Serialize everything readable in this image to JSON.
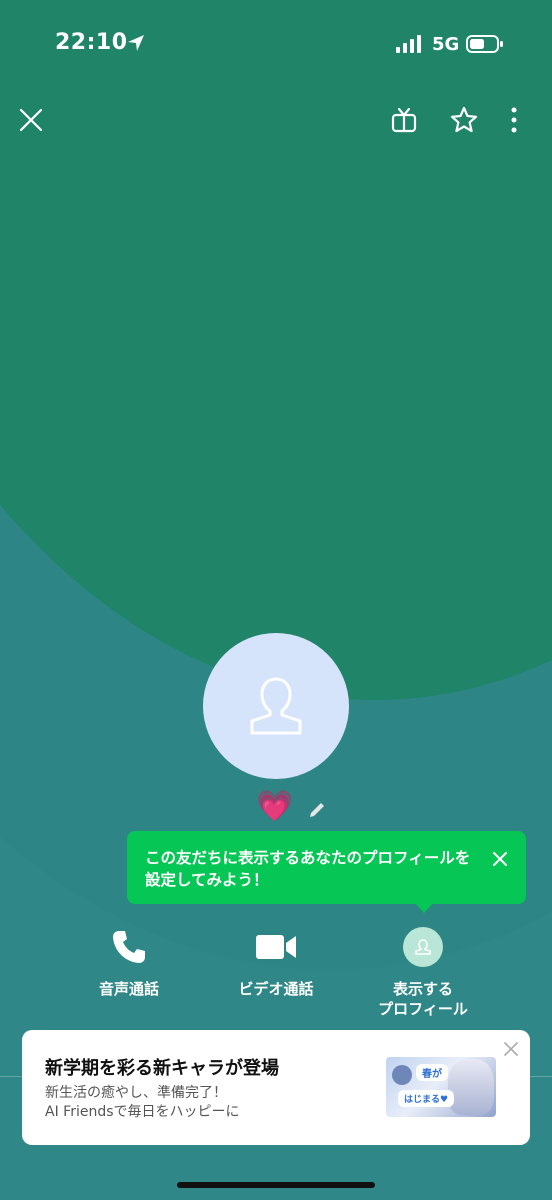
{
  "status_bar": {
    "time": "22:10",
    "network": "5G"
  },
  "top_bar": {
    "icons": [
      "close-icon",
      "gift-box-icon",
      "star-icon",
      "more-vertical-icon"
    ]
  },
  "profile": {
    "status_emoji": "💗"
  },
  "tooltip": {
    "text": "この友だちに表示するあなたのプロフィールを設定してみよう！"
  },
  "actions": [
    {
      "icon": "phone-icon",
      "label": "音声通話"
    },
    {
      "icon": "video-camera-icon",
      "label": "ビデオ通話"
    },
    {
      "icon": "profile-icon",
      "label_line1": "表示する",
      "label_line2": "プロフィール"
    }
  ],
  "ad": {
    "title": "新学期を彩る新キャラが登場",
    "line1": "新生活の癒やし、準備完了！",
    "line2": "AI Friendsで毎日をハッピーに",
    "thumb_text1": "春が",
    "thumb_text2": "はじまる♥"
  },
  "colors": {
    "green_accent": "#06c755",
    "background_teal": "#2e8583",
    "background_green": "#1f8468",
    "avatar_bg": "#d6e4fb"
  }
}
